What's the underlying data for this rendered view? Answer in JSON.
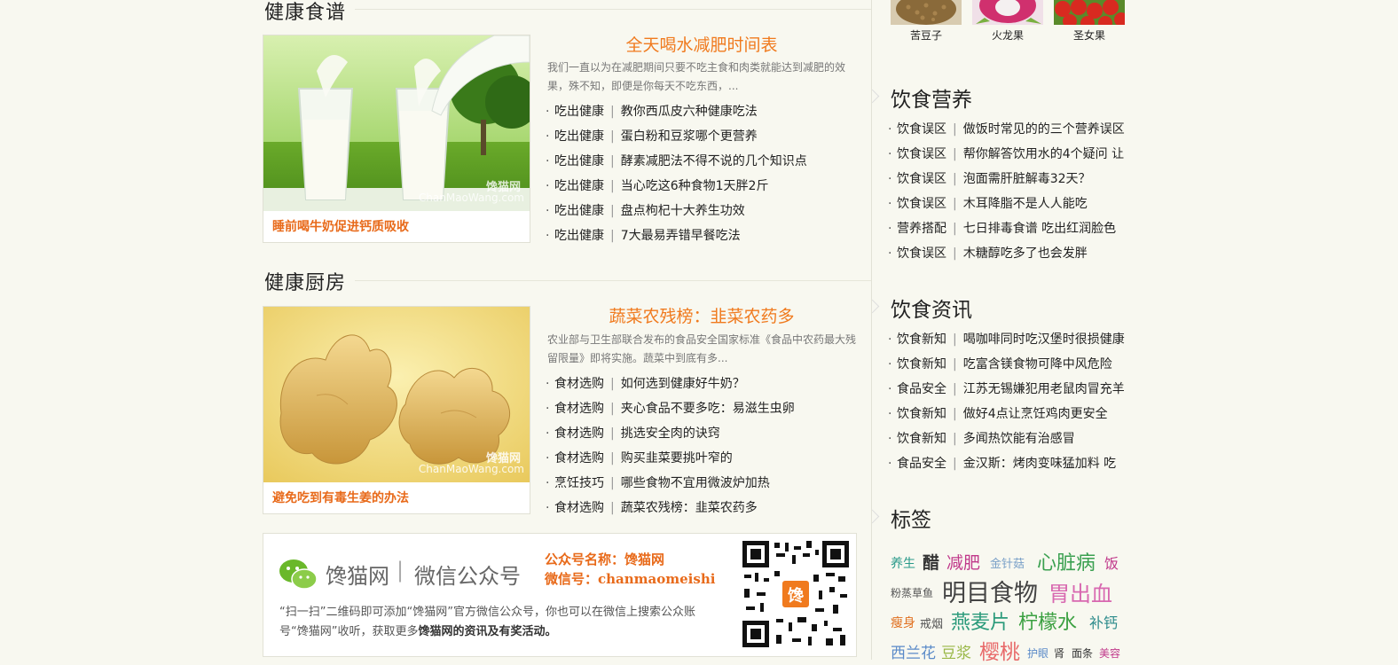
{
  "top_fruits": [
    {
      "label": "苦豆子",
      "color": "#a07a4a"
    },
    {
      "label": "火龙果",
      "color": "#d0306e"
    },
    {
      "label": "圣女果",
      "color": "#d82a20"
    }
  ],
  "recipes": {
    "title": "健康食谱",
    "photo_caption": "睡前喝牛奶促进钙质吸收",
    "watermark_logo": "馋猫网",
    "watermark_url": "ChanMaoWang.com",
    "feature_title": "全天喝水减肥时间表",
    "feature_desc": "我们一直以为在减肥期间只要不吃主食和肉类就能达到减肥的效果，殊不知，即便是你每天不吃东西，...",
    "items": [
      {
        "cat": "吃出健康",
        "text": "教你西瓜皮六种健康吃法"
      },
      {
        "cat": "吃出健康",
        "text": "蛋白粉和豆浆哪个更营养"
      },
      {
        "cat": "吃出健康",
        "text": "酵素减肥法不得不说的几个知识点"
      },
      {
        "cat": "吃出健康",
        "text": "当心吃这6种食物1天胖2斤"
      },
      {
        "cat": "吃出健康",
        "text": "盘点枸杞十大养生功效"
      },
      {
        "cat": "吃出健康",
        "text": "7大最易弄错早餐吃法"
      }
    ]
  },
  "kitchen": {
    "title": "健康厨房",
    "photo_caption": "避免吃到有毒生姜的办法",
    "watermark_logo": "馋猫网",
    "watermark_url": "ChanMaoWang.com",
    "feature_title": "蔬菜农残榜：韭菜农药多",
    "feature_desc": "农业部与卫生部联合发布的食品安全国家标准《食品中农药最大残留限量》即将实施。蔬菜中到底有多...",
    "items": [
      {
        "cat": "食材选购",
        "text": "如何选到健康好牛奶？"
      },
      {
        "cat": "食材选购",
        "text": "夹心食品不要多吃：易滋生虫卵"
      },
      {
        "cat": "食材选购",
        "text": "挑选安全肉的诀窍"
      },
      {
        "cat": "食材选购",
        "text": "购买韭菜要挑叶窄的"
      },
      {
        "cat": "烹饪技巧",
        "text": "哪些食物不宜用微波炉加热"
      },
      {
        "cat": "食材选购",
        "text": "蔬菜农残榜：韭菜农药多"
      }
    ]
  },
  "wechat": {
    "logo_text": "馋猫网",
    "divider": "|",
    "subtitle": "微信公众号",
    "name_label": "公众号名称：馋猫网",
    "id_label": "微信号：chanmaomeishi",
    "desc_part1": "“扫一扫”二维码即可添加“馋猫网”官方微信公众号，你也可以在微信上搜索公众账号“馋猫网”收听，获取更多",
    "desc_bold": "馋猫网的资讯及有奖活动。",
    "qr_badge": "馋"
  },
  "nutrition": {
    "title": "饮食营养",
    "items": [
      {
        "cat": "饮食误区",
        "text": "做饭时常见的的三个营养误区"
      },
      {
        "cat": "饮食误区",
        "text": "帮你解答饮用水的4个疑问 让"
      },
      {
        "cat": "饮食误区",
        "text": "泡面需肝脏解毒32天？"
      },
      {
        "cat": "饮食误区",
        "text": "木耳降脂不是人人能吃"
      },
      {
        "cat": "营养搭配",
        "text": "七日排毒食谱 吃出红润脸色"
      },
      {
        "cat": "饮食误区",
        "text": "木糖醇吃多了也会发胖"
      }
    ]
  },
  "news": {
    "title": "饮食资讯",
    "items": [
      {
        "cat": "饮食新知",
        "text": "喝咖啡同时吃汉堡时很损健康"
      },
      {
        "cat": "饮食新知",
        "text": "吃富含镁食物可降中风危险"
      },
      {
        "cat": "食品安全",
        "text": "江苏无锡嫌犯用老鼠肉冒充羊"
      },
      {
        "cat": "饮食新知",
        "text": "做好4点让烹饪鸡肉更安全"
      },
      {
        "cat": "饮食新知",
        "text": "多闻热饮能有治感冒"
      },
      {
        "cat": "食品安全",
        "text": "金汉斯：烤肉变味猛加料 吃"
      }
    ]
  },
  "tags": {
    "title": "标签",
    "items": [
      {
        "text": "养生",
        "color": "#2a9a8a"
      },
      {
        "text": "醋",
        "color": "#333333"
      },
      {
        "text": "减肥",
        "color": "#c0388a"
      },
      {
        "text": "金针菇",
        "color": "#7aa0c8"
      },
      {
        "text": "心脏病",
        "color": "#3aa050"
      },
      {
        "text": "饭",
        "color": "#c0388a"
      },
      {
        "text": "粉蒸草鱼",
        "color": "#555555"
      },
      {
        "text": "明目食物",
        "color": "#444444"
      },
      {
        "text": "胃出血",
        "color": "#d868b0"
      },
      {
        "text": "瘦身",
        "color": "#e07020"
      },
      {
        "text": "戒烟",
        "color": "#555555"
      },
      {
        "text": "燕麦片",
        "color": "#2a9a7a"
      },
      {
        "text": "柠檬水",
        "color": "#3aa040"
      },
      {
        "text": "补钙",
        "color": "#2a8a8a"
      },
      {
        "text": "西兰花",
        "color": "#5a8ac8"
      },
      {
        "text": "豆浆",
        "color": "#9ab848"
      },
      {
        "text": "樱桃",
        "color": "#e86a6a"
      },
      {
        "text": "护眼",
        "color": "#5a8ac8"
      },
      {
        "text": "肾",
        "color": "#333333"
      },
      {
        "text": "面条",
        "color": "#333333"
      },
      {
        "text": "美容",
        "color": "#c0388a"
      }
    ]
  }
}
